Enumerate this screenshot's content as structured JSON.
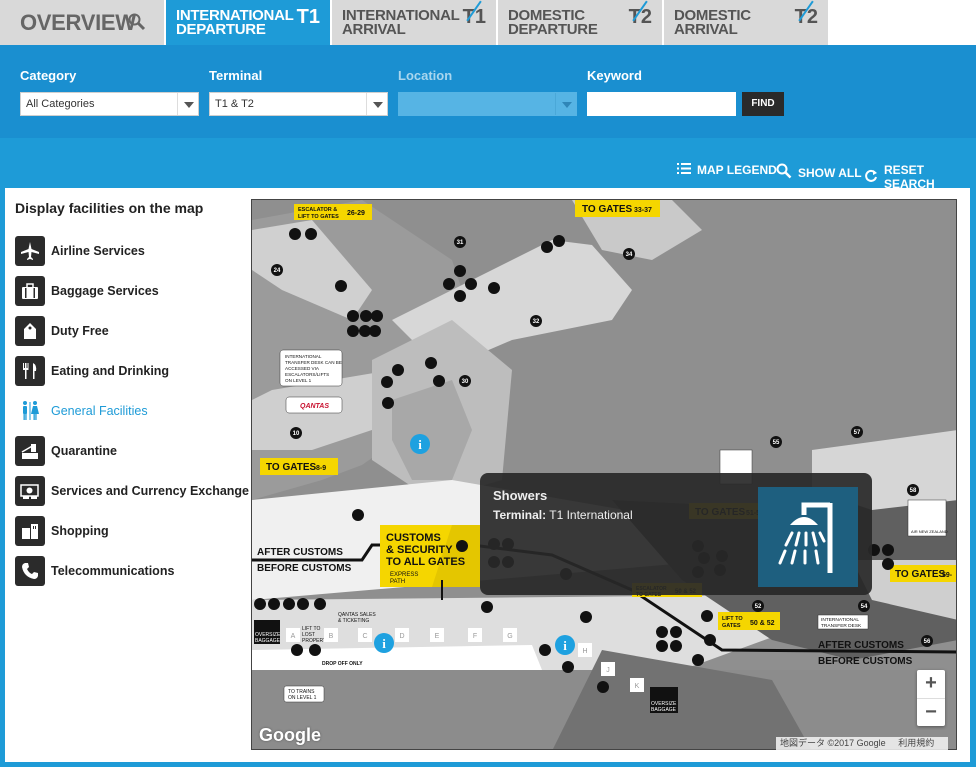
{
  "tabs": [
    {
      "label": "OVERVIEW",
      "badge": ""
    },
    {
      "label": "INTERNATIONAL\nDEPARTURE",
      "badge": "T1"
    },
    {
      "label": "INTERNATIONAL\nARRIVAL",
      "badge": "T1"
    },
    {
      "label": "DOMESTIC\nDEPARTURE",
      "badge": "T2"
    },
    {
      "label": "DOMESTIC\nARRIVAL",
      "badge": "T2"
    }
  ],
  "filters": {
    "category_label": "Category",
    "category_value": "All Categories",
    "terminal_label": "Terminal",
    "terminal_value": "T1 & T2",
    "location_label": "Location",
    "location_value": "",
    "keyword_label": "Keyword",
    "keyword_value": "",
    "find_label": "FIND"
  },
  "toolbar": {
    "legend": "MAP LEGEND",
    "show_all": "SHOW ALL",
    "reset": "RESET SEARCH"
  },
  "sidebar": {
    "title": "Display facilities on the map",
    "items": [
      {
        "label": "Airline Services",
        "icon": "airplane-icon"
      },
      {
        "label": "Baggage Services",
        "icon": "baggage-icon"
      },
      {
        "label": "Duty Free",
        "icon": "duty-free-icon"
      },
      {
        "label": "Eating and Drinking",
        "icon": "cutlery-icon"
      },
      {
        "label": "General Facilities",
        "icon": "restroom-icon"
      },
      {
        "label": "Quarantine",
        "icon": "quarantine-icon"
      },
      {
        "label": "Services and Currency Exchange",
        "icon": "currency-icon"
      },
      {
        "label": "Shopping",
        "icon": "shopping-icon"
      },
      {
        "label": "Telecommunications",
        "icon": "phone-icon"
      }
    ]
  },
  "map": {
    "signs": {
      "escalator_26_29": "ESCALATOR & LIFT TO GATES",
      "gates_26_29": "26-29",
      "to_gates": "TO GATES",
      "gates_33_37": "33-37",
      "gates_8_9": "8-9",
      "gates_51_53": "51-53",
      "gates_59": "59-",
      "after_customs": "AFTER CUSTOMS",
      "before_customs": "BEFORE CUSTOMS",
      "customs_security": "CUSTOMS & SECURITY TO ALL GATES",
      "express_path": "EXPRESS PATH",
      "transfer_note": "INTERNATIONAL TRANSFER DESK CAN BE ACCESSED VIA ESCALATORS/LIFTS ON LEVEL 1",
      "qantas": "QANTAS",
      "qantas_sales": "QANTAS SALES & TICKETING",
      "lift_to_lost": "LIFT TO LOST PROPERTY",
      "drop_off": "DROP OFF ONLY",
      "to_trains": "TO TRAINS ON LEVEL 1",
      "oversize_baggage": "OVERSIZE BAGGAGE",
      "escalator_50_52": "ESCALATOR TO GATES",
      "gates_50_52": "50 & 52",
      "lift_to_gates": "LIFT TO GATES",
      "intl_transfer_desk": "INTERNATIONAL TRANSFER DESK",
      "air_new_zealand": "AIR NEW ZEALAND"
    },
    "gates": [
      "24",
      "31",
      "34",
      "32",
      "30",
      "10",
      "55",
      "57",
      "58",
      "54",
      "56"
    ],
    "counters": [
      "A",
      "B",
      "C",
      "D",
      "E",
      "F",
      "G",
      "H",
      "J",
      "K"
    ],
    "google": "Google",
    "attribution": [
      "地図データ ©2017 Google",
      "利用規約"
    ]
  },
  "popup": {
    "title": "Showers",
    "terminal_label": "Terminal:",
    "terminal_value": "T1 International",
    "icon": "shower-icon"
  },
  "colors": {
    "brand_blue": "#1e9bd7",
    "sign_yellow": "#f5d600",
    "map_grey": "#8f8f8f"
  }
}
